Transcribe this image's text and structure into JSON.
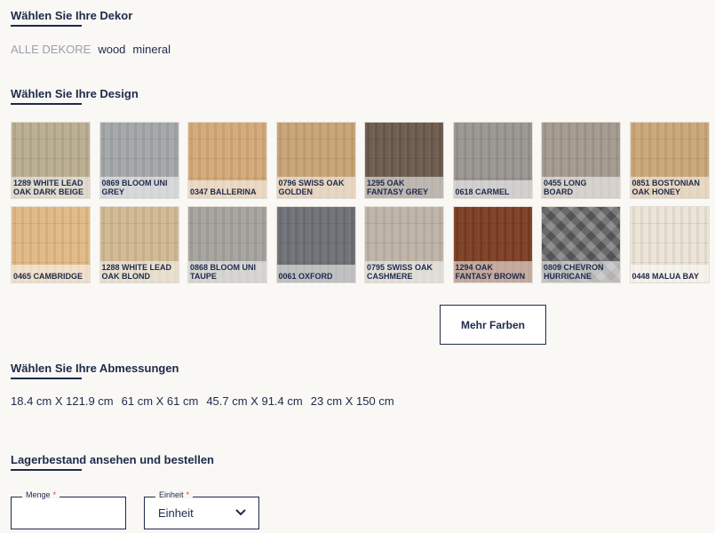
{
  "sections": {
    "decor_title": "Wählen Sie Ihre Dekor",
    "design_title": "Wählen Sie Ihre Design",
    "dimensions_title": "Wählen Sie Ihre Abmessungen",
    "order_title": "Lagerbestand ansehen und bestellen"
  },
  "filters": [
    "ALLE DEKORE",
    "wood",
    "mineral"
  ],
  "designs": [
    {
      "label": "1289 WHITE LEAD OAK DARK BEIGE",
      "color": "#b9ad8f"
    },
    {
      "label": "0869 BLOOM UNI GREY",
      "color": "#a3a6a9"
    },
    {
      "label": "0347 BALLERINA",
      "color": "#d4a877"
    },
    {
      "label": "0796 SWISS OAK GOLDEN",
      "color": "#c7a274"
    },
    {
      "label": "1295 OAK FANTASY GREY",
      "color": "#6b5a4d"
    },
    {
      "label": "0618 CARMEL",
      "color": "#999591"
    },
    {
      "label": "0455 LONG BOARD",
      "color": "#a3998e"
    },
    {
      "label": "0851 BOSTONIAN OAK HONEY",
      "color": "#c9a677"
    },
    {
      "label": "0465 CAMBRIDGE",
      "color": "#e0b985"
    },
    {
      "label": "1288 WHITE LEAD OAK BLOND",
      "color": "#d0b891"
    },
    {
      "label": "0868 BLOOM UNI TAUPE",
      "color": "#a4a29c"
    },
    {
      "label": "0061 OXFORD",
      "color": "#6e7075"
    },
    {
      "label": "0795 SWISS OAK CASHMERE",
      "color": "#bdb3a6"
    },
    {
      "label": "1294 OAK FANTASY BROWN",
      "color": "#7b3e22"
    },
    {
      "label": "0809 CHEVRON HURRICANE",
      "color": "#6d6c6e"
    },
    {
      "label": "0448 MALUA BAY",
      "color": "#ebe3d5"
    }
  ],
  "more_button": "Mehr Farben",
  "dimensions": [
    "18.4 cm X 121.9 cm",
    "61 cm X 61 cm",
    "45.7 cm X 91.4 cm",
    "23 cm X 150 cm"
  ],
  "quantity": {
    "label": "Menge",
    "required": "*",
    "value": ""
  },
  "unit": {
    "label": "Einheit",
    "required": "*",
    "value": "Einheit"
  },
  "colors": {
    "navy": "#1e2a4a",
    "required": "#e0383e",
    "background": "#f9f8f5"
  }
}
